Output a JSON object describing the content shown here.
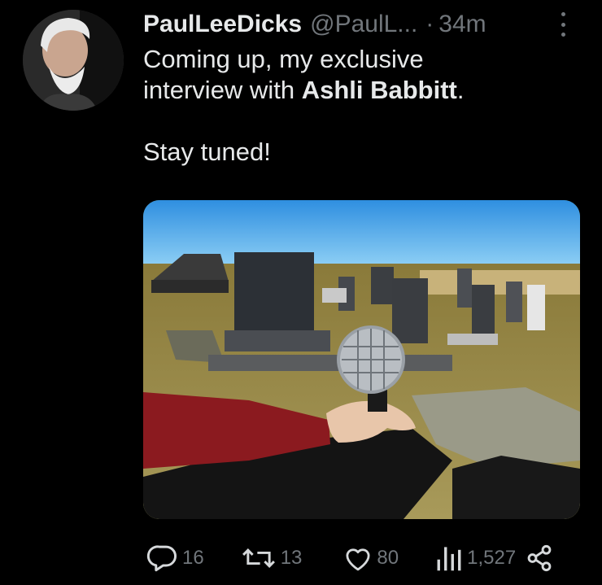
{
  "author": {
    "display_name": "PaulLeeDicks",
    "handle": "@PaulL...",
    "separator": "·",
    "time": "34m"
  },
  "tweet": {
    "line1": "Coming up, my exclusive",
    "line2_prefix": "interview with ",
    "line2_bold": "Ashli Babbitt",
    "line2_suffix": ".",
    "line3": "Stay tuned!"
  },
  "actions": {
    "replies": "16",
    "reposts": "13",
    "likes": "80",
    "views": "1,527"
  },
  "icons": {
    "reply": "reply-bubble-icon",
    "repost": "repost-arrows-icon",
    "like": "heart-icon",
    "views": "bar-chart-icon",
    "share": "share-nodes-icon",
    "more": "more-vertical-icon"
  },
  "colors": {
    "background": "#000000",
    "text": "#e7e9ea",
    "muted": "#71767b"
  }
}
